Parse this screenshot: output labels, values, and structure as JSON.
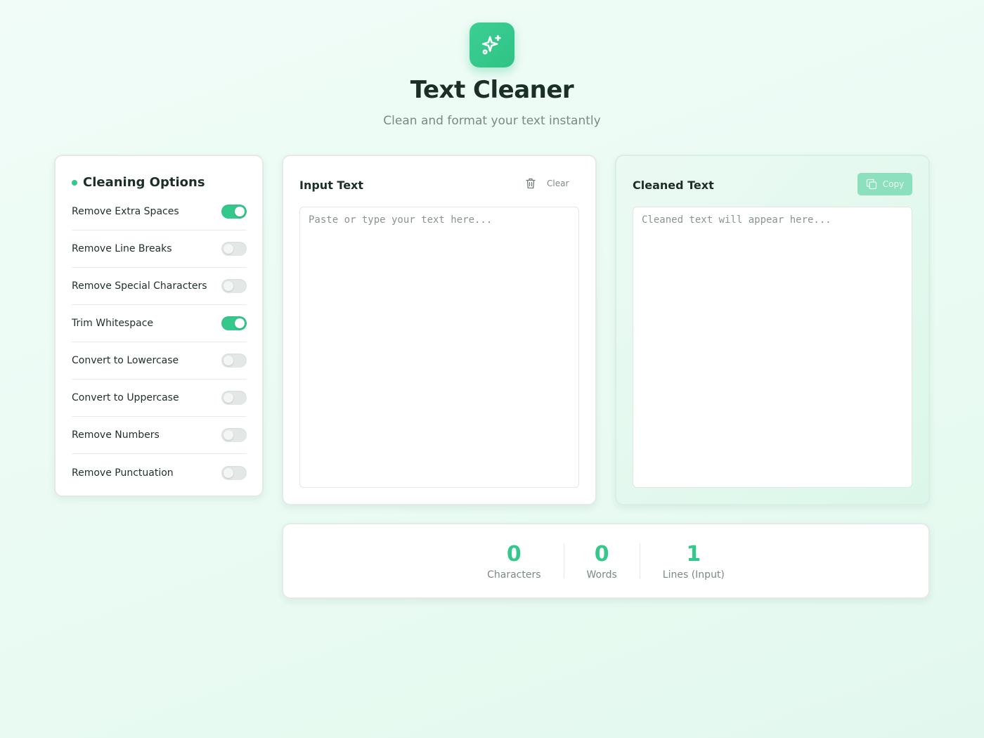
{
  "app": {
    "logo_icon": "sparkles-icon",
    "title": "Text Cleaner",
    "subtitle": "Clean and format your text instantly",
    "accent_color": "#34c88c"
  },
  "options": {
    "title": "Cleaning Options",
    "items": [
      {
        "label": "Remove Extra Spaces",
        "enabled": true
      },
      {
        "label": "Remove Line Breaks",
        "enabled": false
      },
      {
        "label": "Remove Special Characters",
        "enabled": false
      },
      {
        "label": "Trim Whitespace",
        "enabled": true
      },
      {
        "label": "Convert to Lowercase",
        "enabled": false
      },
      {
        "label": "Convert to Uppercase",
        "enabled": false
      },
      {
        "label": "Remove Numbers",
        "enabled": false
      },
      {
        "label": "Remove Punctuation",
        "enabled": false
      }
    ]
  },
  "input": {
    "title": "Input Text",
    "clear_label": "Clear",
    "clear_icon": "trash-icon",
    "value": "",
    "placeholder": "Paste or type your text here..."
  },
  "output": {
    "title": "Cleaned Text",
    "copy_label": "Copy",
    "copy_icon": "copy-icon",
    "placeholder": "Cleaned text will appear here..."
  },
  "stats": {
    "characters": {
      "value": "0",
      "label": "Characters"
    },
    "words": {
      "value": "0",
      "label": "Words"
    },
    "lines": {
      "value": "1",
      "label": "Lines (Input)"
    }
  }
}
